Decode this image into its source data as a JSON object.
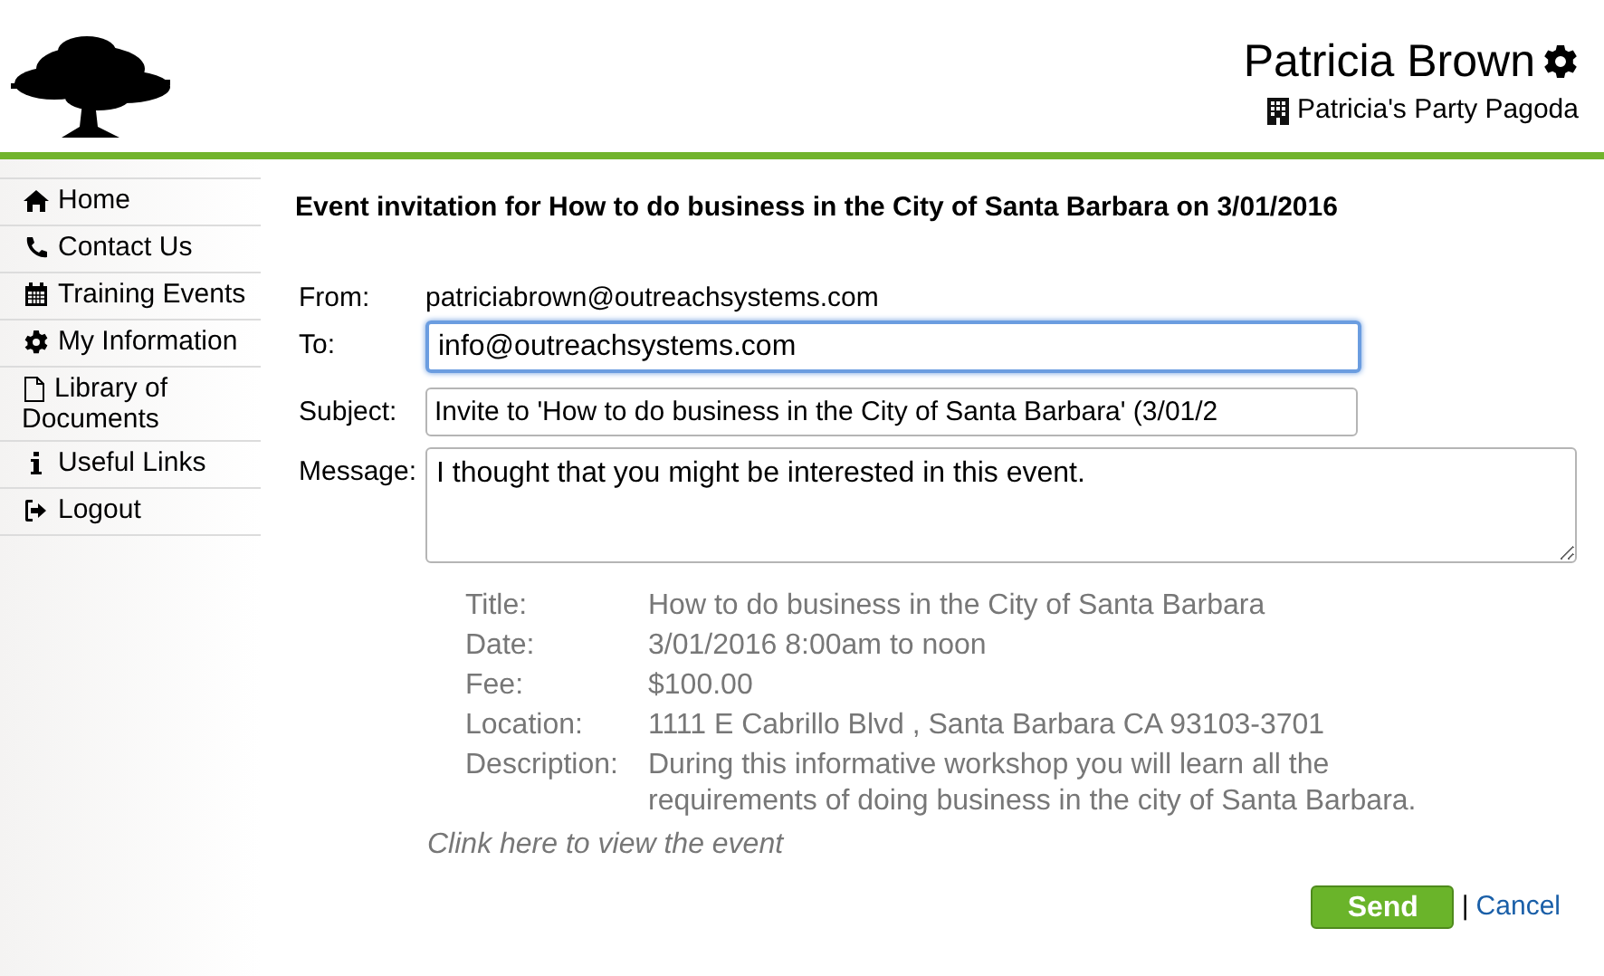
{
  "header": {
    "user_name": "Patricia Brown",
    "organization": "Patricia's Party Pagoda"
  },
  "sidebar": {
    "items": [
      {
        "label": "Home"
      },
      {
        "label": "Contact Us"
      },
      {
        "label": "Training Events"
      },
      {
        "label": "My Information"
      },
      {
        "label": "Library of Documents"
      },
      {
        "label": "Useful Links"
      },
      {
        "label": "Logout"
      }
    ]
  },
  "heading": "Event invitation for How to do business in the City of Santa Barbara on 3/01/2016",
  "form": {
    "from": {
      "label": "From:",
      "value": "patriciabrown@outreachsystems.com"
    },
    "to": {
      "label": "To:",
      "value": "info@outreachsystems.com",
      "focused": true
    },
    "subject": {
      "label": "Subject:",
      "value": "Invite to 'How to do business in the City of Santa Barbara' (3/01/2",
      "focused": false
    },
    "message": {
      "label": "Message:",
      "value": "I thought that you might be interested in this event.",
      "focused": false
    }
  },
  "event_details": [
    {
      "label": "Title:",
      "value": "How to do business in the City of Santa Barbara"
    },
    {
      "label": "Date:",
      "value": "3/01/2016 8:00am to noon"
    },
    {
      "label": "Fee:",
      "value": "$100.00"
    },
    {
      "label": "Location:",
      "value": "1111 E Cabrillo Blvd , Santa Barbara CA 93103-3701"
    },
    {
      "label": "Description:",
      "value": "During this informative workshop you will learn all the requirements of doing business in the city of Santa Barbara."
    }
  ],
  "event_link": "Clink here to view the event",
  "actions": {
    "send": "Send",
    "separator": "|",
    "cancel": "Cancel"
  }
}
